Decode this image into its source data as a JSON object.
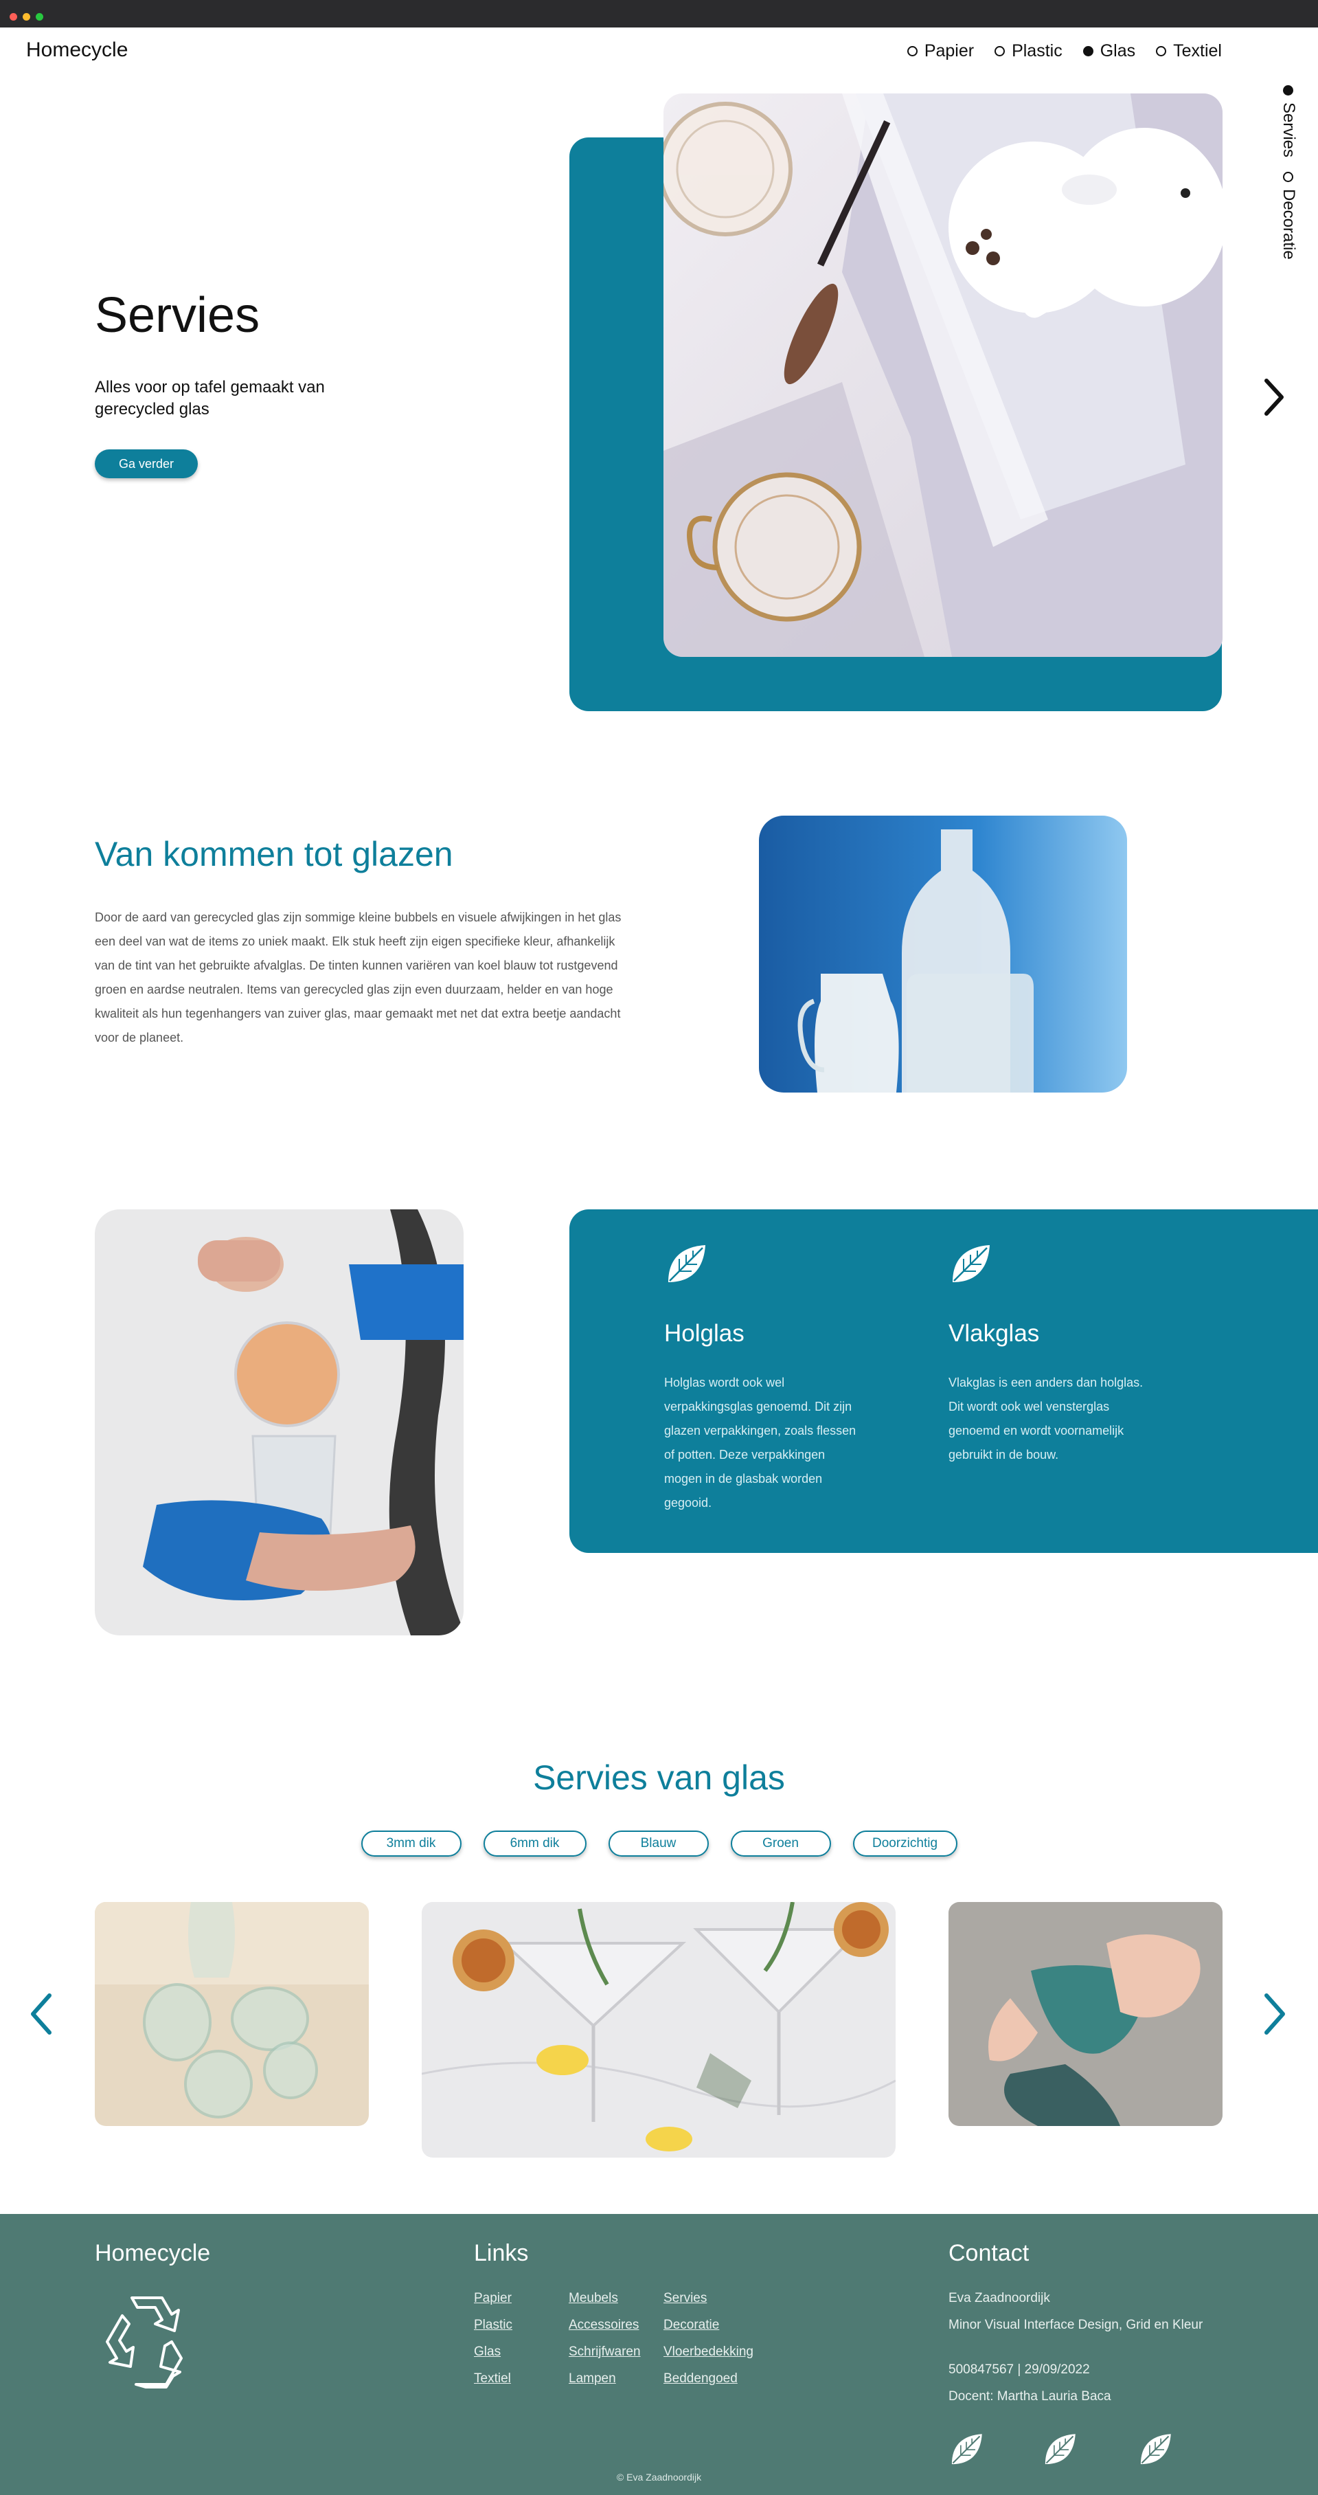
{
  "header": {
    "logo": "Homecycle",
    "nav": [
      {
        "label": "Papier",
        "active": false
      },
      {
        "label": "Plastic",
        "active": false
      },
      {
        "label": "Glas",
        "active": true
      },
      {
        "label": "Textiel",
        "active": false
      }
    ]
  },
  "side_nav": [
    {
      "label": "Servies",
      "active": true
    },
    {
      "label": "Decoratie",
      "active": false
    }
  ],
  "hero": {
    "title": "Servies",
    "subtitle": "Alles voor op tafel gemaakt van gerecycled glas",
    "button": "Ga verder"
  },
  "intro": {
    "title": "Van kommen tot glazen",
    "body": "Door de aard van gerecycled glas zijn sommige kleine bubbels en visuele afwijkingen in het glas een deel van wat de items zo uniek maakt. Elk stuk heeft zijn eigen specifieke kleur, afhankelijk van de tint van het gebruikte afvalglas. De tinten kunnen variëren van koel blauw tot rustgevend groen en aardse neutralen. Items van gerecycled glas zijn even duurzaam, helder en van hoge kwaliteit als hun tegenhangers van zuiver glas, maar gemaakt met net dat extra beetje aandacht voor de planeet."
  },
  "features": [
    {
      "icon": "leaf-icon",
      "title": "Holglas",
      "text": "Holglas wordt ook wel verpakkingsglas genoemd. Dit zijn glazen verpakkingen, zoals flessen of potten. Deze verpakkingen mogen in de glasbak worden gegooid."
    },
    {
      "icon": "leaf-icon",
      "title": "Vlakglas",
      "text": "Vlakglas is een anders dan holglas. Dit wordt ook wel vensterglas genoemd en wordt voornamelijk gebruikt in de bouw."
    }
  ],
  "collection": {
    "title": "Servies van glas",
    "filters": [
      "3mm dik",
      "6mm dik",
      "Blauw",
      "Groen",
      "Doorzichtig"
    ]
  },
  "footer": {
    "brand": "Homecycle",
    "links_title": "Links",
    "links_col1": [
      "Papier",
      "Plastic",
      "Glas",
      "Textiel"
    ],
    "links_col2": [
      "Meubels",
      "Accessoires",
      "Schrijfwaren",
      "Lampen"
    ],
    "links_col3": [
      "Servies",
      "Decoratie",
      "Vloerbedekking",
      "Beddengoed"
    ],
    "contact_title": "Contact",
    "contact_name": "Eva Zaadnoordijk",
    "contact_course": "Minor Visual Interface Design, Grid en Kleur",
    "contact_id": "500847567 | 29/09/2022",
    "contact_teacher": "Docent: Martha Lauria Baca",
    "copyright": "© Eva Zaadnoordijk"
  },
  "colors": {
    "accent": "#0e7f9b",
    "footer_bg": "#4f7a73"
  }
}
